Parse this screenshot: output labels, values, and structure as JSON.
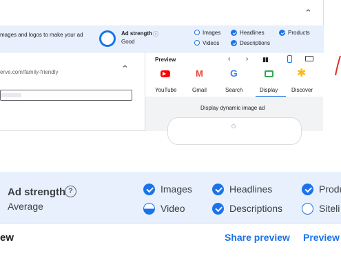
{
  "top": {
    "banner_text": "mages and logos to make your ad",
    "ad_strength_label": "Ad strength",
    "ad_strength_value": "Good",
    "checks": [
      {
        "label": "Images",
        "status": "empty"
      },
      {
        "label": "Headlines",
        "status": "done"
      },
      {
        "label": "Products",
        "status": "done"
      },
      {
        "label": "Videos",
        "status": "empty"
      },
      {
        "label": "Descriptions",
        "status": "done"
      }
    ],
    "url_text": "erve.com/family-friendly",
    "preview_title": "Preview",
    "tabs": [
      "YouTube",
      "Gmail",
      "Search",
      "Display",
      "Discover"
    ],
    "active_tab": "Display",
    "display_caption": "Display dynamic image ad",
    "icons": {
      "youtube": "youtube-icon",
      "gmail": "gmail-icon",
      "search": "google-icon",
      "display": "display-icon",
      "discover": "discover-icon"
    }
  },
  "bottom": {
    "ad_strength_label": "Ad strength",
    "ad_strength_value": "Average",
    "checks": [
      {
        "label": "Images",
        "status": "done"
      },
      {
        "label": "Headlines",
        "status": "done"
      },
      {
        "label": "Produ",
        "status": "done"
      },
      {
        "label": "Video",
        "status": "partial"
      },
      {
        "label": "Descriptions",
        "status": "done"
      },
      {
        "label": "Siteli",
        "status": "empty"
      }
    ],
    "section_title": "ew",
    "share_preview": "Share preview",
    "preview_link": "Preview"
  },
  "colors": {
    "accent": "#1a73e8",
    "banner": "#e8f0fe",
    "red_arrow": "#d93025"
  }
}
